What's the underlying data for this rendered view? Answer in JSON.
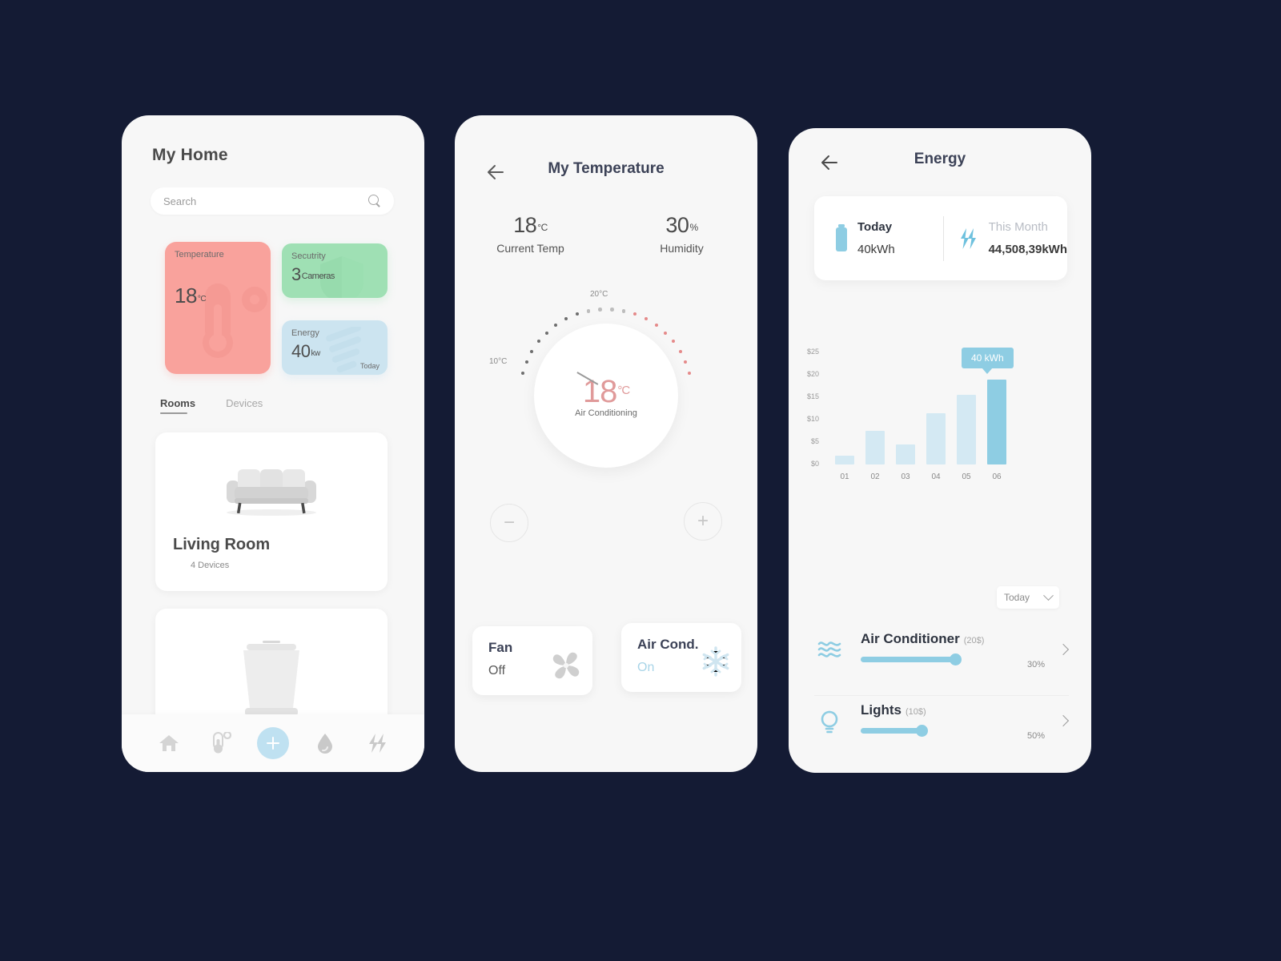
{
  "theme": {
    "background": "#141B34",
    "phone_bg": "#F7F7F7",
    "accent_blue": "#8ECDE3",
    "accent_blue_light": "#D4E9F3",
    "coral": "#F9A29C",
    "green": "#9FE0B4",
    "pale_blue": "#CCE4F0"
  },
  "home": {
    "title": "My Home",
    "search": {
      "placeholder": "Search",
      "value": "",
      "icon": "search-icon"
    },
    "stats": {
      "temperature": {
        "label": "Temperature",
        "value": "18",
        "unit": "°C",
        "icon": "thermometer-icon",
        "color": "#F9A29C"
      },
      "security": {
        "label": "Secutrity",
        "value": "3",
        "unit": "Cameras",
        "icon": "shield-icon",
        "color": "#9FE0B4"
      },
      "energy": {
        "label": "Energy",
        "value": "40",
        "unit": "kw",
        "sub": "Today",
        "icon": "fan-icon",
        "color": "#CCE4F0"
      }
    },
    "tabs": [
      {
        "label": "Rooms",
        "active": true
      },
      {
        "label": "Devices",
        "active": false
      }
    ],
    "rooms": [
      {
        "name": "Living Room",
        "devices": "4 Devices",
        "art": "sofa-illustration"
      },
      {
        "name": "",
        "devices": "",
        "art": "washer-illustration"
      }
    ],
    "nav": [
      {
        "name": "home-icon",
        "active": true
      },
      {
        "name": "thermometer-icon",
        "active": false
      },
      {
        "name": "add-icon",
        "active": false,
        "fab": true
      },
      {
        "name": "water-drop-icon",
        "active": false
      },
      {
        "name": "bolt-icon",
        "active": false
      }
    ]
  },
  "temperature": {
    "title": "My Temperature",
    "back_icon": "back-arrow-icon",
    "stats": [
      {
        "value": "18",
        "unit": "°C",
        "caption": "Current Temp"
      },
      {
        "value": "30",
        "unit": "%",
        "caption": "Humidity"
      }
    ],
    "dial": {
      "min_label": "10°C",
      "max_label": "20°C",
      "value": "18",
      "unit": "°C",
      "mode": "Air Conditioning"
    },
    "stepper": {
      "minus": "−",
      "plus": "+"
    },
    "devices": [
      {
        "name": "Fan",
        "state": "Off",
        "on": false,
        "icon": "fan-icon"
      },
      {
        "name": "Air Cond.",
        "state": "On",
        "on": true,
        "icon": "snowflake-icon"
      }
    ]
  },
  "energy": {
    "title": "Energy",
    "back_icon": "back-arrow-icon",
    "summary": [
      {
        "label": "Today",
        "value": "40kWh",
        "icon": "battery-icon",
        "muted": false
      },
      {
        "label": "This Month",
        "value": "44,508,39kWh",
        "icon": "bolt-icon",
        "muted": true
      }
    ],
    "tooltip": "40 kWh",
    "dropdown": {
      "value": "Today",
      "icon": "chevron-down-icon"
    },
    "devices": [
      {
        "name": "Air Conditioner",
        "cost": "(20$)",
        "percent": "30%",
        "fill": 0.62,
        "icon": "waves-icon",
        "chevron": "chevron-right-icon"
      },
      {
        "name": "Lights",
        "cost": "(10$)",
        "percent": "50%",
        "fill": 0.4,
        "icon": "bulb-icon",
        "chevron": "chevron-right-icon"
      }
    ]
  },
  "chart_data": {
    "type": "bar",
    "title": "",
    "categories": [
      "01",
      "02",
      "03",
      "04",
      "05",
      "06"
    ],
    "values": [
      2,
      7.5,
      4.5,
      11.5,
      15.5,
      19
    ],
    "highlight_index": 5,
    "highlight_label": "40 kWh",
    "ylabel": "",
    "xlabel": "",
    "ytick_labels": [
      "$25",
      "$20",
      "$15",
      "$10",
      "$5",
      "$0"
    ],
    "ytick_values": [
      25,
      20,
      15,
      10,
      5,
      0
    ],
    "ylim": [
      0,
      25
    ],
    "grid": false,
    "legend": "none",
    "bar_color": "#D4E9F3",
    "highlight_color": "#8ECDE3"
  }
}
